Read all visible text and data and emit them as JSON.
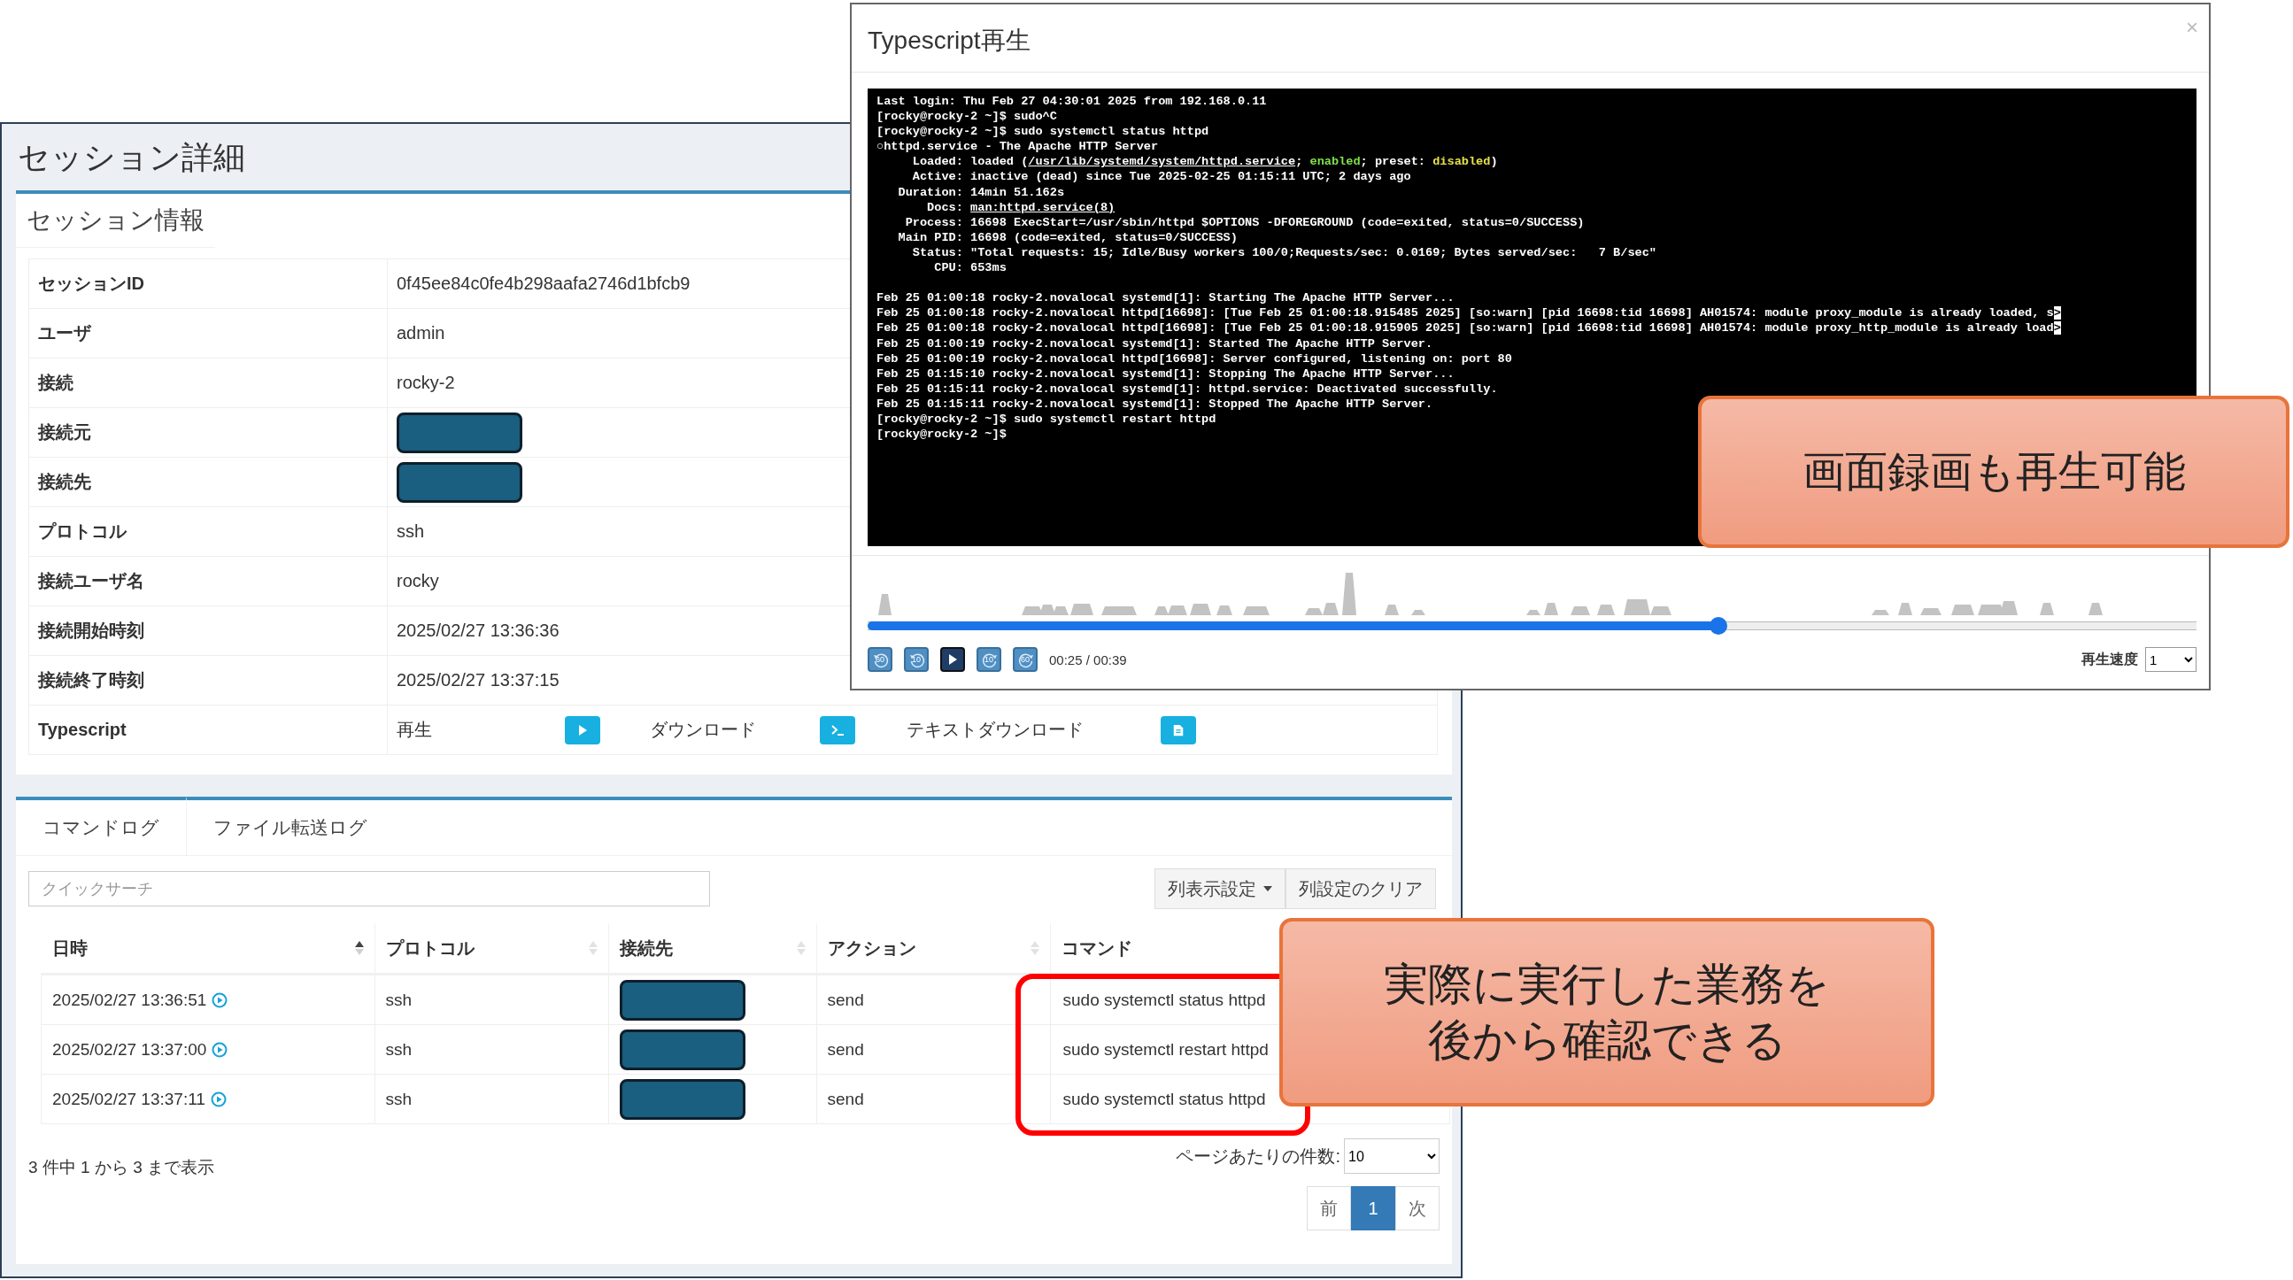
{
  "session_window": {
    "title": "セッション詳細",
    "card_title": "セッション情報",
    "fields": [
      {
        "label": "セッションID",
        "value": "0f45ee84c0fe4b298aafa2746d1bfcb9"
      },
      {
        "label": "ユーザ",
        "value": "admin"
      },
      {
        "label": "接続",
        "value": "rocky-2"
      },
      {
        "label": "接続元",
        "redacted": true
      },
      {
        "label": "接続先",
        "redacted": true
      },
      {
        "label": "プロトコル",
        "value": "ssh"
      },
      {
        "label": "接続ユーザ名",
        "value": "rocky"
      },
      {
        "label": "接続開始時刻",
        "value": "2025/02/27 13:36:36"
      },
      {
        "label": "接続終了時刻",
        "value": "2025/02/27 13:37:15"
      }
    ],
    "typescript": {
      "label": "Typescript",
      "actions": [
        {
          "label": "再生"
        },
        {
          "label": "ダウンロード"
        },
        {
          "label": "テキストダウンロード"
        }
      ]
    }
  },
  "log_panel": {
    "tabs": [
      {
        "label": "コマンドログ",
        "selected": true
      },
      {
        "label": "ファイル転送ログ",
        "selected": false
      }
    ],
    "search": {
      "placeholder": "クイックサーチ"
    },
    "buttons": [
      {
        "label": "列表示設定",
        "dropdown": true
      },
      {
        "label": "列設定のクリア",
        "dropdown": false
      }
    ],
    "columns": [
      {
        "label": "日時",
        "kind": "sortable",
        "sorted": true
      },
      {
        "label": "プロトコル",
        "kind": "sortable",
        "sorted": false
      },
      {
        "label": "接続先",
        "kind": "sortable",
        "sorted": false
      },
      {
        "label": "アクション",
        "kind": "sortable",
        "sorted": false
      },
      {
        "label": "コマンド",
        "kind": "plain"
      }
    ],
    "rows": [
      {
        "datetime": "2025/02/27 13:36:51",
        "protocol": "ssh",
        "destination_redacted": true,
        "action": "send",
        "command": "sudo systemctl status httpd"
      },
      {
        "datetime": "2025/02/27 13:37:00",
        "protocol": "ssh",
        "destination_redacted": true,
        "action": "send",
        "command": "sudo systemctl restart httpd"
      },
      {
        "datetime": "2025/02/27 13:37:11",
        "protocol": "ssh",
        "destination_redacted": true,
        "action": "send",
        "command": "sudo systemctl status httpd"
      }
    ],
    "highlight_commands": true,
    "summary": "3 件中 1 から 3 まで表示",
    "page_size": {
      "label": "ページあたりの件数:",
      "value": "10"
    },
    "pagination": [
      {
        "label": "前",
        "selected": false
      },
      {
        "label": "1",
        "selected": true
      },
      {
        "label": "次",
        "selected": false
      }
    ]
  },
  "replay_modal": {
    "title": "Typescript再生",
    "close": "×",
    "terminal_blocks": [
      [
        [
          {
            "text": "Last login: Thu Feb 27 04:30:01 2025 from 192.168.0.11",
            "kind": "plain"
          }
        ],
        [
          {
            "text": "[rocky@rocky-2 ~]$ sudo^C",
            "kind": "plain"
          }
        ],
        [
          {
            "text": "[rocky@rocky-2 ~]$ sudo systemctl status httpd",
            "kind": "plain"
          }
        ],
        [
          {
            "text": "○",
            "kind": "plain"
          },
          {
            "text": "httpd.service - The Apache HTTP Server",
            "kind": "plain"
          }
        ],
        [
          {
            "text": "     Loaded: loaded (",
            "kind": "plain"
          },
          {
            "text": "/usr/lib/systemd/system/httpd.service",
            "kind": "link"
          },
          {
            "text": "; ",
            "kind": "plain"
          },
          {
            "text": "enabled",
            "kind": "green"
          },
          {
            "text": "; preset: ",
            "kind": "plain"
          },
          {
            "text": "disabled",
            "kind": "yellow"
          },
          {
            "text": ")",
            "kind": "plain"
          }
        ],
        [
          {
            "text": "     Active: inactive (dead) since Tue 2025-02-25 01:15:11 UTC; 2 days ago",
            "kind": "plain"
          }
        ],
        [
          {
            "text": "   Duration: 14min 51.162s",
            "kind": "plain"
          }
        ],
        [
          {
            "text": "       Docs: ",
            "kind": "plain"
          },
          {
            "text": "man:httpd.service(8)",
            "kind": "link"
          }
        ],
        [
          {
            "text": "    Process: 16698 ExecStart=/usr/sbin/httpd $OPTIONS -DFOREGROUND (code=exited, status=0/SUCCESS)",
            "kind": "plain"
          }
        ],
        [
          {
            "text": "   Main PID: 16698 (code=exited, status=0/SUCCESS)",
            "kind": "plain"
          }
        ],
        [
          {
            "text": "     Status: \"Total requests: 15; Idle/Busy workers 100/0;Requests/sec: 0.0169; Bytes served/sec:   7 B/sec\"",
            "kind": "plain"
          }
        ],
        [
          {
            "text": "        CPU: 653ms",
            "kind": "plain"
          }
        ]
      ],
      [
        [
          {
            "text": "Feb 25 01:00:18 rocky-2.novalocal systemd[1]: Starting The Apache HTTP Server...",
            "kind": "plain"
          }
        ],
        [
          {
            "text": "Feb 25 01:00:18 rocky-2.novalocal httpd[16698]: [Tue Feb 25 01:00:18.915485 2025] [so:warn] [pid 16698:tid 16698] AH01574: module proxy_module is already loaded, s",
            "kind": "plain"
          },
          {
            "text": ">",
            "kind": "cursor"
          }
        ],
        [
          {
            "text": "Feb 25 01:00:18 rocky-2.novalocal httpd[16698]: [Tue Feb 25 01:00:18.915905 2025] [so:warn] [pid 16698:tid 16698] AH01574: module proxy_http_module is already load",
            "kind": "plain"
          },
          {
            "text": ">",
            "kind": "cursor"
          }
        ],
        [
          {
            "text": "Feb 25 01:00:19 rocky-2.novalocal systemd[1]: Started The Apache HTTP Server.",
            "kind": "plain"
          }
        ],
        [
          {
            "text": "Feb 25 01:00:19 rocky-2.novalocal httpd[16698]: Server configured, listening on: port 80",
            "kind": "plain"
          }
        ],
        [
          {
            "text": "Feb 25 01:15:10 rocky-2.novalocal systemd[1]: Stopping The Apache HTTP Server...",
            "kind": "plain"
          }
        ],
        [
          {
            "text": "Feb 25 01:15:11 rocky-2.novalocal systemd[1]: httpd.service: Deactivated successfully.",
            "kind": "plain"
          }
        ],
        [
          {
            "text": "Feb 25 01:15:11 rocky-2.novalocal systemd[1]: Stopped The Apache HTTP Server.",
            "kind": "plain"
          }
        ],
        [
          {
            "text": "[rocky@rocky-2 ~]$ sudo systemctl restart httpd",
            "kind": "plain"
          }
        ],
        [
          {
            "text": "[rocky@rocky-2 ~]$",
            "kind": "plain"
          }
        ]
      ]
    ],
    "playback": {
      "level": 0.64,
      "controls": [
        {
          "kind": "rewind",
          "label": "60"
        },
        {
          "kind": "rewind",
          "label": "10"
        },
        {
          "kind": "play"
        },
        {
          "kind": "forward",
          "label": "10"
        },
        {
          "kind": "forward",
          "label": "60"
        }
      ],
      "time": "00:25 / 00:39",
      "speed_label": "再生速度",
      "speed": "1"
    }
  },
  "callouts": [
    {
      "lines": [
        "画面録画も再生可能"
      ]
    },
    {
      "lines": [
        "実際に実行した業務を",
        "後から確認できる"
      ]
    }
  ]
}
